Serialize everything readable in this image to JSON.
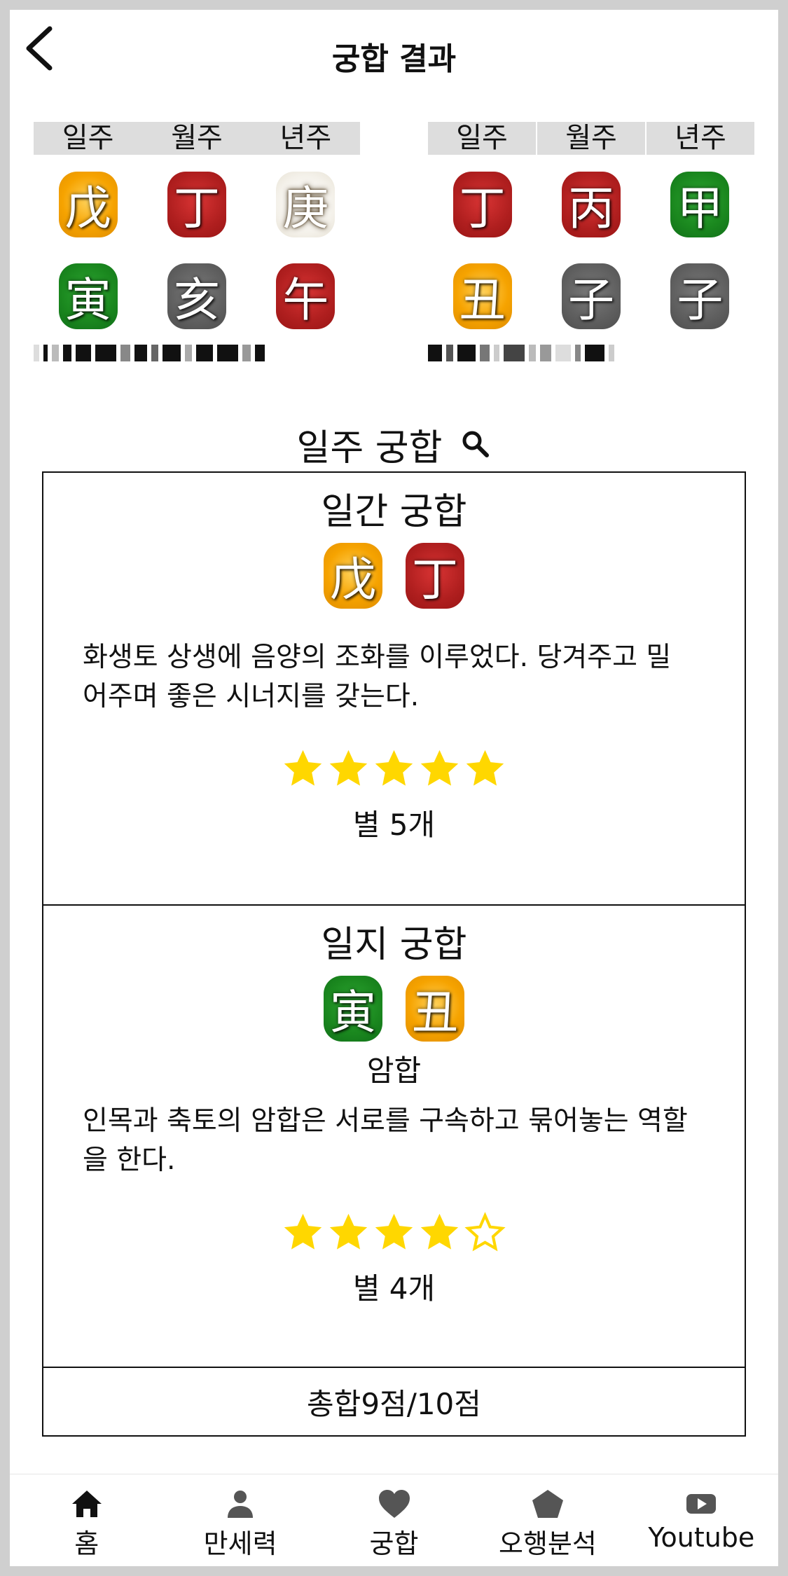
{
  "header": {
    "title": "궁합 결과"
  },
  "left_chart": {
    "headers": [
      "일주",
      "월주",
      "년주"
    ],
    "stems": [
      {
        "char": "戊",
        "color": "orange"
      },
      {
        "char": "丁",
        "color": "red"
      },
      {
        "char": "庚",
        "color": "white"
      }
    ],
    "branches": [
      {
        "char": "寅",
        "color": "green"
      },
      {
        "char": "亥",
        "color": "gray"
      },
      {
        "char": "午",
        "color": "red"
      }
    ]
  },
  "right_chart": {
    "headers": [
      "일주",
      "월주",
      "년주"
    ],
    "stems": [
      {
        "char": "丁",
        "color": "red"
      },
      {
        "char": "丙",
        "color": "red"
      },
      {
        "char": "甲",
        "color": "green"
      }
    ],
    "branches": [
      {
        "char": "丑",
        "color": "orange"
      },
      {
        "char": "子",
        "color": "gray"
      },
      {
        "char": "子",
        "color": "gray"
      }
    ]
  },
  "section": {
    "title": "일주 궁합",
    "icon": "search-icon"
  },
  "day_stem_match": {
    "title": "일간 궁합",
    "chips": [
      {
        "char": "戊",
        "color": "orange"
      },
      {
        "char": "丁",
        "color": "red"
      }
    ],
    "description": "화생토 상생에 음양의 조화를 이루었다. 당겨주고 밀어주며 좋은 시너지를 갖는다.",
    "stars": 5,
    "score_label": "별 5개"
  },
  "day_branch_match": {
    "title": "일지 궁합",
    "chips": [
      {
        "char": "寅",
        "color": "green"
      },
      {
        "char": "丑",
        "color": "orange"
      }
    ],
    "relation": "암합",
    "description": "인목과 축토의 암합은 서로를 구속하고 묶어놓는 역할을 한다.",
    "stars": 4,
    "score_label": "별 4개"
  },
  "total": {
    "label": "총합9점/10점"
  },
  "nav": {
    "items": [
      {
        "label": "홈",
        "icon": "home-icon"
      },
      {
        "label": "만세력",
        "icon": "person-icon"
      },
      {
        "label": "궁합",
        "icon": "heart-icon"
      },
      {
        "label": "오행분석",
        "icon": "pentagon-icon"
      },
      {
        "label": "Youtube",
        "icon": "youtube-icon"
      }
    ]
  },
  "colors": {
    "orange": "#f6a300",
    "red": "#b01f1f",
    "green": "#1a871e",
    "gray": "#5f5f5f",
    "star": "#ffd700",
    "header_bg": "#dddddd"
  }
}
